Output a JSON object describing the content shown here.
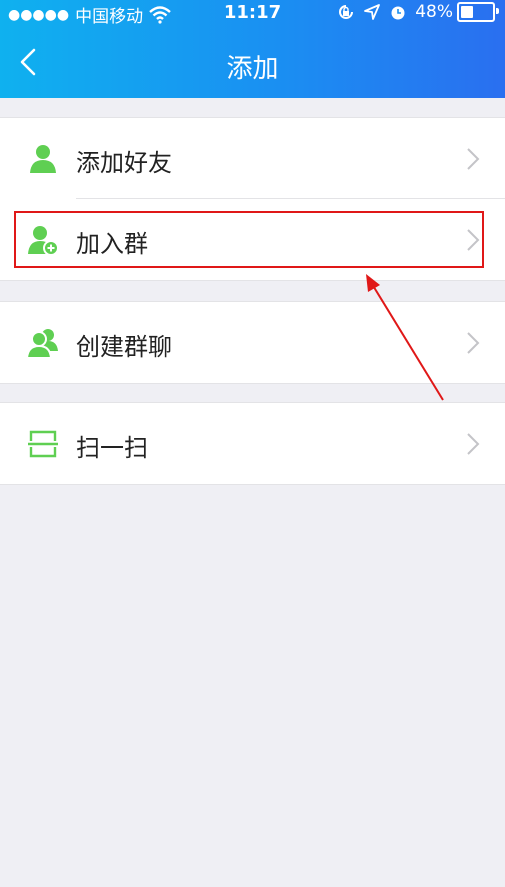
{
  "status_bar": {
    "signal_dots": "●●●●●",
    "carrier": "中国移动",
    "time": "11:17",
    "battery_percent": "48%",
    "battery_level": 0.48
  },
  "nav": {
    "title": "添加",
    "back_icon": "chevron-left-icon"
  },
  "menu": {
    "items": [
      {
        "label": "添加好友",
        "icon": "person-icon"
      },
      {
        "label": "加入群",
        "icon": "person-add-icon",
        "highlighted": true
      },
      {
        "label": "创建群聊",
        "icon": "people-icon"
      },
      {
        "label": "扫一扫",
        "icon": "scan-icon"
      }
    ]
  },
  "colors": {
    "header_gradient_start": "#0fb1ef",
    "header_gradient_end": "#2a6ff0",
    "icon_green": "#5fcf52",
    "highlight_red": "#e01818"
  }
}
